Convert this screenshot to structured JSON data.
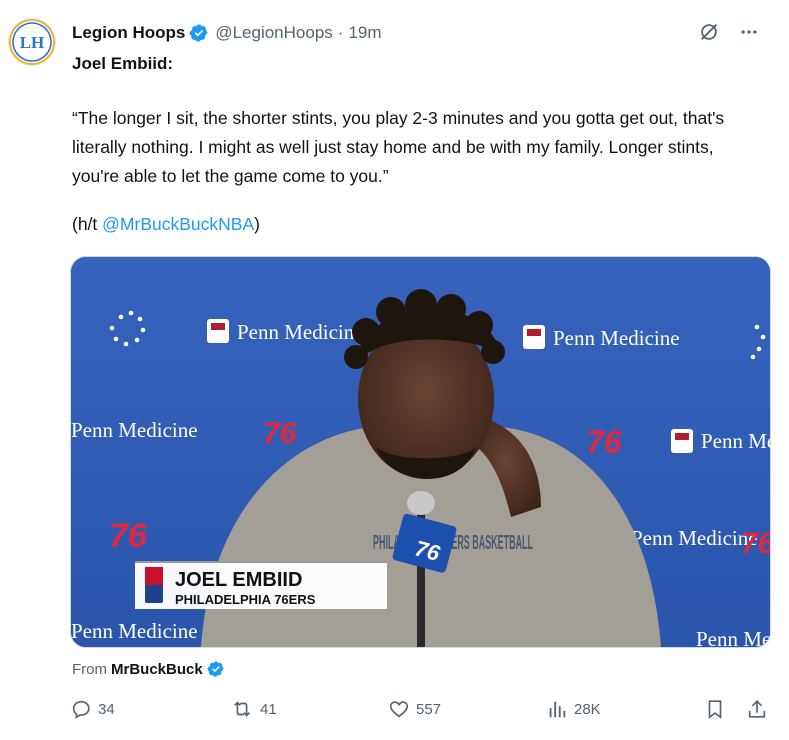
{
  "tweet": {
    "author_name": "Legion Hoops",
    "handle": "@LegionHoops",
    "separator": "·",
    "time": "19m",
    "subject": "Joel Embiid:",
    "quote": "“The longer I sit, the shorter stints, you play 2-3 minutes and you gotta get out, that's literally nothing. I might as well just stay home and be with my family. Longer stints, you're able to let the game come to you.”",
    "ht_prefix": "(h/t ",
    "ht_link": "@MrBuckBuckNBA",
    "ht_suffix": ")",
    "avatar_text": "LH"
  },
  "media": {
    "lower_third_name": "JOEL EMBIID",
    "lower_third_team": "PHILADELPHIA 76ERS",
    "backdrop_sponsor": "Penn Medicine",
    "backdrop_logo": "76",
    "shirt_text": "PHILADELPHIA 76ERS BASKETBALL"
  },
  "from": {
    "label": "From",
    "source": "MrBuckBuck"
  },
  "actions": {
    "replies": "34",
    "reposts": "41",
    "likes": "557",
    "views": "28K"
  },
  "colors": {
    "accent": "#1d9bf0",
    "muted": "#536471",
    "backdrop": "#2f5bb3",
    "logo_red": "#e0283c"
  }
}
